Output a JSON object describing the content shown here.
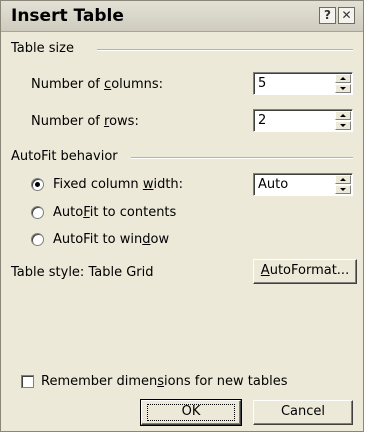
{
  "dialog": {
    "title": "Insert Table",
    "help_glyph": "?",
    "close_glyph": "✕"
  },
  "table_size": {
    "heading": "Table size",
    "columns": {
      "label_pre": "Number of ",
      "label_key": "c",
      "label_post": "olumns:",
      "value": "5"
    },
    "rows": {
      "label_pre": "Number of ",
      "label_key": "r",
      "label_post": "ows:",
      "value": "2"
    }
  },
  "autofit": {
    "heading": "AutoFit behavior",
    "fixed": {
      "pre": "Fixed column ",
      "key": "w",
      "post": "idth:",
      "checked": true
    },
    "fixed_value": "Auto",
    "contents": {
      "pre": "Auto",
      "key": "F",
      "post": "it to contents",
      "checked": false
    },
    "window": {
      "pre": "AutoFit to win",
      "key": "d",
      "post": "ow",
      "checked": false
    }
  },
  "table_style": {
    "label": "Table style:",
    "value": "Table Grid",
    "autoformat": {
      "pre": "",
      "key": "A",
      "post": "utoFormat..."
    }
  },
  "remember": {
    "pre": "Remember dimen",
    "key": "s",
    "post": "ions for new tables",
    "checked": false
  },
  "buttons": {
    "ok": "OK",
    "cancel": "Cancel"
  }
}
